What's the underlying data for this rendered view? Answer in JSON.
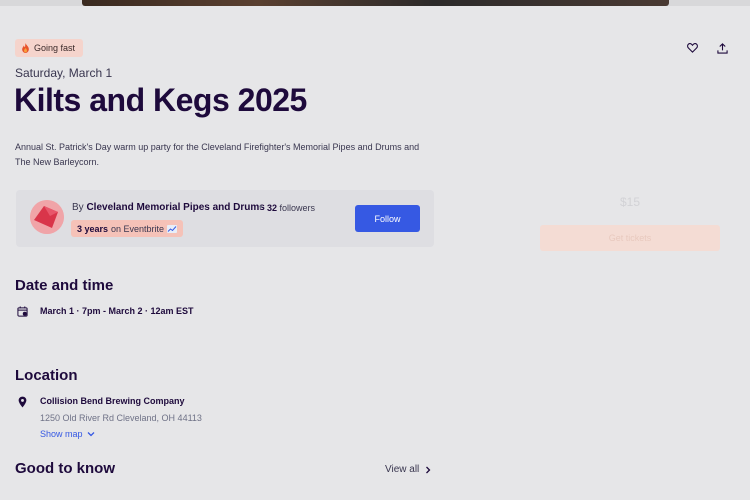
{
  "badge": {
    "label": "Going fast",
    "icon": "flame-icon"
  },
  "actions": {
    "like_icon": "heart-icon",
    "share_icon": "share-icon"
  },
  "event": {
    "date": "Saturday, March 1",
    "title": "Kilts and Kegs 2025",
    "summary": "Annual St. Patrick's Day warm up party for the Cleveland Firefighter's Memorial Pipes and Drums and The New Barleycorn."
  },
  "organizer": {
    "by_prefix": "By",
    "name": "Cleveland Memorial Pipes and Drums",
    "dot": "•",
    "followers_count": "32",
    "followers_label": "followers",
    "years": "3 years",
    "years_suffix": "on Eventbrite",
    "follow_label": "Follow"
  },
  "ticket": {
    "price": "$15",
    "button_label": "Get tickets"
  },
  "date_time": {
    "heading": "Date and time",
    "value": "March 1 · 7pm - March 2 · 12am EST"
  },
  "location": {
    "heading": "Location",
    "venue": "Collision Bend Brewing Company",
    "address": "1250 Old River Rd Cleveland, OH 44113",
    "show_map": "Show map"
  },
  "good_to_know": {
    "heading": "Good to know",
    "view_all": "View all"
  },
  "colors": {
    "accent": "#3659e3",
    "title": "#1e0a3c",
    "badge_bg": "#f5d4cc"
  }
}
